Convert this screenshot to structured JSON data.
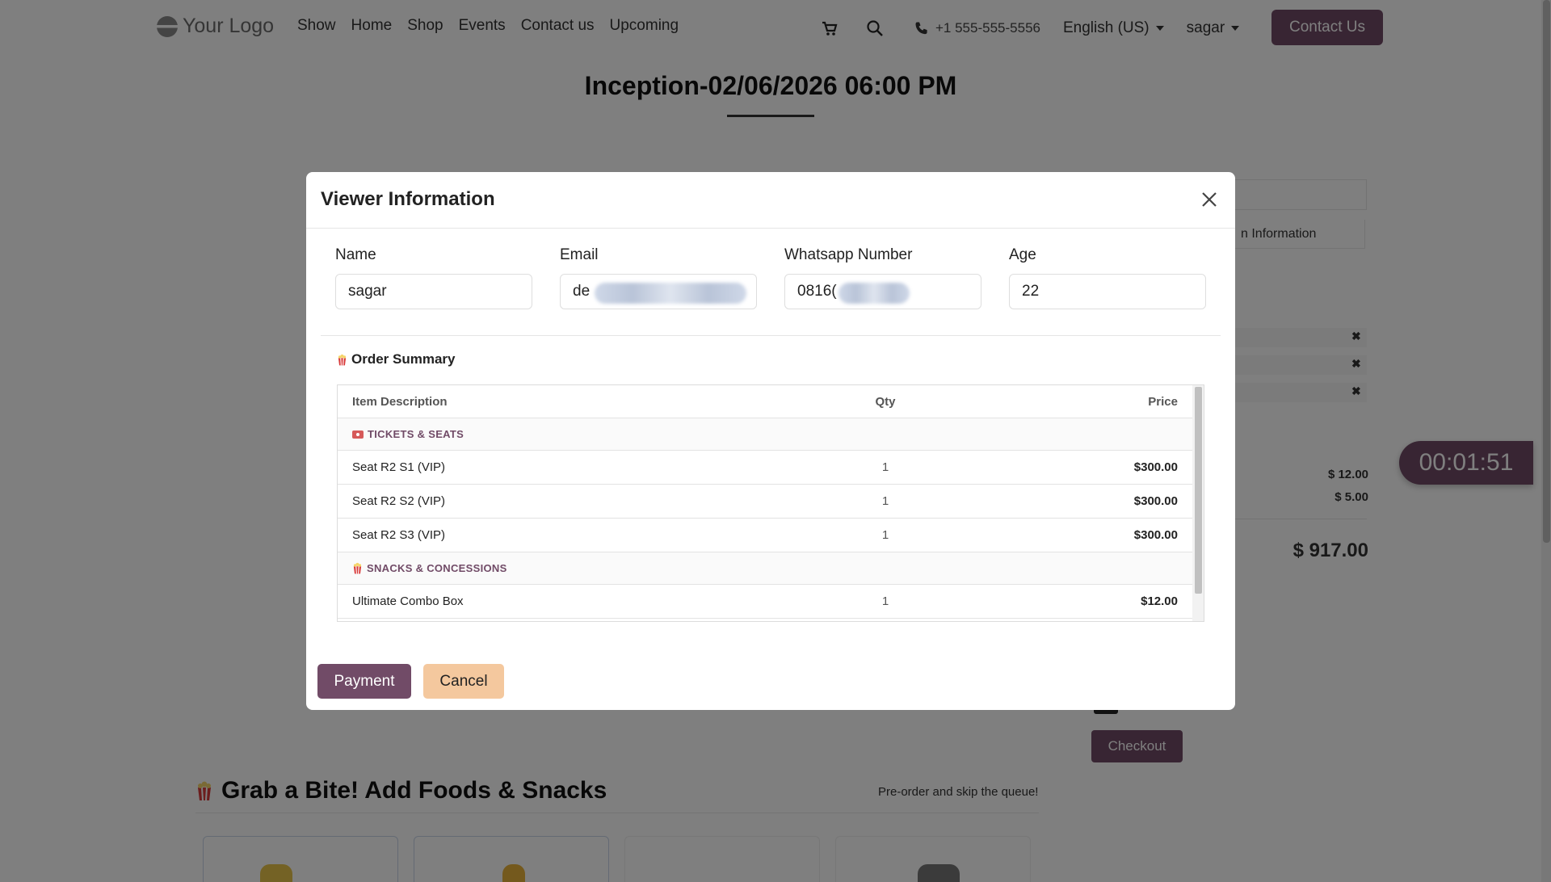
{
  "navbar": {
    "logo_text": "Your Logo",
    "links": [
      "Show",
      "Home",
      "Shop",
      "Events",
      "Contact us",
      "Upcoming"
    ],
    "phone": "+1 555-555-5556",
    "language": "English (US)",
    "user": "sagar",
    "contact_button": "Contact Us"
  },
  "page": {
    "show_title": "Inception-02/06/2026 06:00 PM",
    "side_tab_label": "n Information",
    "fees": [
      "$ 12.00",
      "$ 5.00"
    ],
    "total": "$ 917.00",
    "timer": "00:01:51",
    "checkout_button": "Checkout",
    "snacks_heading": "Grab a Bite! Add Foods & Snacks",
    "snacks_subtext": "Pre-order and skip the queue!"
  },
  "modal": {
    "title": "Viewer Information",
    "fields": {
      "name": {
        "label": "Name",
        "value": "sagar"
      },
      "email": {
        "label": "Email",
        "value": "de"
      },
      "whatsapp": {
        "label": "Whatsapp Number",
        "value": "0816("
      },
      "age": {
        "label": "Age",
        "value": "22"
      }
    },
    "order_summary": {
      "title": "Order Summary",
      "headers": {
        "desc": "Item Description",
        "qty": "Qty",
        "price": "Price"
      },
      "sections": [
        {
          "label": "TICKETS & SEATS",
          "items": [
            {
              "desc": "Seat R2 S1 (VIP)",
              "qty": "1",
              "price": "$300.00"
            },
            {
              "desc": "Seat R2 S2 (VIP)",
              "qty": "1",
              "price": "$300.00"
            },
            {
              "desc": "Seat R2 S3 (VIP)",
              "qty": "1",
              "price": "$300.00"
            }
          ]
        },
        {
          "label": "SNACKS & CONCESSIONS",
          "items": [
            {
              "desc": "Ultimate Combo Box",
              "qty": "1",
              "price": "$12.00"
            }
          ]
        }
      ]
    },
    "payment_button": "Payment",
    "cancel_button": "Cancel"
  },
  "colors": {
    "brand": "#714b67",
    "cancel": "#f4c89e",
    "backdrop": "rgba(0,0,0,0.5)"
  },
  "icons": [
    "cart-icon",
    "search-icon",
    "phone-icon",
    "close-icon",
    "popcorn-icon",
    "ticket-icon"
  ]
}
